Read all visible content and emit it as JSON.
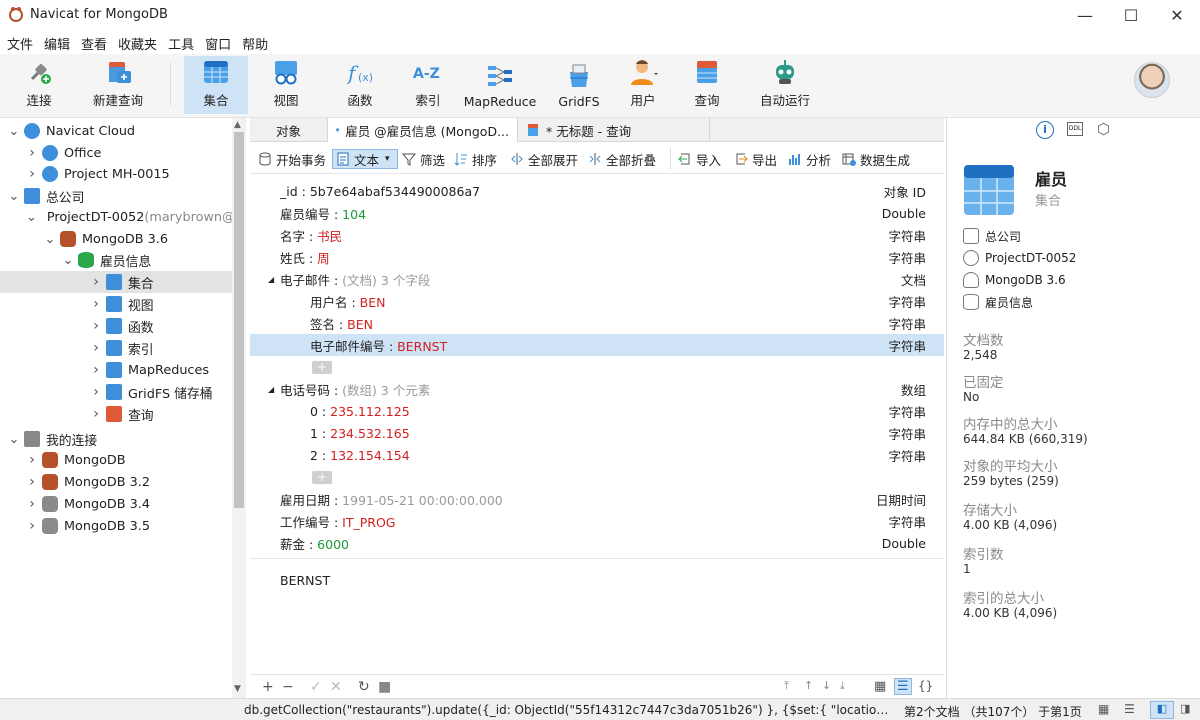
{
  "window": {
    "title": "Navicat for MongoDB",
    "minimize": "—",
    "maximize": "☐",
    "close": "✕"
  },
  "menu": [
    "文件",
    "编辑",
    "查看",
    "收藏夹",
    "工具",
    "窗口",
    "帮助"
  ],
  "toolbar": [
    {
      "label": "连接",
      "icon": "plug-icon"
    },
    {
      "label": "新建查询",
      "icon": "new-query-icon"
    },
    {
      "label": "集合",
      "icon": "collection-icon",
      "active": true
    },
    {
      "label": "视图",
      "icon": "view-icon"
    },
    {
      "label": "函数",
      "icon": "function-icon"
    },
    {
      "label": "索引",
      "icon": "index-icon"
    },
    {
      "label": "MapReduce",
      "icon": "mapreduce-icon"
    },
    {
      "label": "GridFS",
      "icon": "gridfs-icon"
    },
    {
      "label": "用户",
      "icon": "user-icon"
    },
    {
      "label": "查询",
      "icon": "query-icon"
    },
    {
      "label": "自动运行",
      "icon": "robot-icon"
    }
  ],
  "tree": [
    {
      "label": "Navicat Cloud",
      "depth": 0,
      "arrow": "down",
      "icon": "cloud-icon",
      "color": "#3c8fd8"
    },
    {
      "label": "Office",
      "depth": 1,
      "arrow": "right",
      "icon": "project-icon",
      "color": "#3c8fd8"
    },
    {
      "label": "Project MH-0015",
      "depth": 1,
      "arrow": "right",
      "icon": "project-icon",
      "color": "#3c8fd8"
    },
    {
      "label": "总公司",
      "depth": 0,
      "arrow": "down",
      "icon": "company-icon",
      "color": "#3c8fd8"
    },
    {
      "label": "ProjectDT-0052",
      "sub": " (marybrown@",
      "depth": 1,
      "arrow": "down",
      "icon": "project-icon",
      "color": "#3c8fd8"
    },
    {
      "label": "MongoDB 3.6",
      "depth": 2,
      "arrow": "down",
      "icon": "mongodb-icon",
      "color": "#b5522a"
    },
    {
      "label": "雇员信息",
      "depth": 3,
      "arrow": "down",
      "icon": "database-icon",
      "color": "#2aa84a"
    },
    {
      "label": "集合",
      "depth": 4,
      "arrow": "right",
      "icon": "collection-icon",
      "color": "#3c8fd8",
      "selected": true
    },
    {
      "label": "视图",
      "depth": 4,
      "arrow": "right",
      "icon": "view-icon",
      "color": "#3c8fd8"
    },
    {
      "label": "函数",
      "depth": 4,
      "arrow": "right",
      "icon": "function-icon",
      "color": "#3c8fd8"
    },
    {
      "label": "索引",
      "depth": 4,
      "arrow": "right",
      "icon": "index-icon",
      "color": "#3c8fd8"
    },
    {
      "label": "MapReduces",
      "depth": 4,
      "arrow": "right",
      "icon": "mapreduce-icon",
      "color": "#3c8fd8"
    },
    {
      "label": "GridFS 储存桶",
      "depth": 4,
      "arrow": "right",
      "icon": "gridfs-icon",
      "color": "#3c8fd8"
    },
    {
      "label": "查询",
      "depth": 4,
      "arrow": "right",
      "icon": "query-icon",
      "color": "#e05a3a"
    },
    {
      "label": "我的连接",
      "depth": 0,
      "arrow": "down",
      "icon": "connection-icon",
      "color": "#888888"
    },
    {
      "label": "MongoDB",
      "depth": 1,
      "arrow": "right",
      "icon": "mongodb-icon",
      "color": "#b5522a"
    },
    {
      "label": "MongoDB 3.2",
      "depth": 1,
      "arrow": "right",
      "icon": "mongodb-icon",
      "color": "#b5522a"
    },
    {
      "label": "MongoDB 3.4",
      "depth": 1,
      "arrow": "right",
      "icon": "mongodb-icon",
      "color": "#8a8a8a"
    },
    {
      "label": "MongoDB 3.5",
      "depth": 1,
      "arrow": "right",
      "icon": "mongodb-icon",
      "color": "#8a8a8a"
    }
  ],
  "tabs": [
    "对象",
    "雇员 @雇员信息 (MongoD...",
    "* 无标题 - 查询"
  ],
  "subtoolbar": [
    "开始事务",
    "文本",
    "筛选",
    "排序",
    "全部展开",
    "全部折叠",
    "导入",
    "导出",
    "分析",
    "数据生成"
  ],
  "document": [
    {
      "key": "_id : ",
      "value": "5b7e64abaf5344900086a7",
      "vclass": "",
      "type": "对象 ID",
      "indent": 0
    },
    {
      "key": "雇员编号 : ",
      "value": "104",
      "vclass": "v-num",
      "type": "Double",
      "indent": 0
    },
    {
      "key": "名字 : ",
      "value": "书民",
      "vclass": "v-str",
      "type": "字符串",
      "indent": 0
    },
    {
      "key": "姓氏 : ",
      "value": "周",
      "vclass": "v-str",
      "type": "字符串",
      "indent": 0
    },
    {
      "key": "电子邮件 : ",
      "value": "(文档) 3 个字段",
      "vclass": "v-gray",
      "type": "文档",
      "indent": 0,
      "expand": true
    },
    {
      "key": "用户名 : ",
      "value": "BEN",
      "vclass": "v-str",
      "type": "字符串",
      "indent": 1
    },
    {
      "key": "签名 : ",
      "value": "BEN",
      "vclass": "v-str",
      "type": "字符串",
      "indent": 1
    },
    {
      "key": "电子邮件编号 : ",
      "value": "BERNST",
      "vclass": "v-str",
      "type": "字符串",
      "indent": 1,
      "selected": true
    },
    {
      "plus": true,
      "indent": 1
    },
    {
      "key": "电话号码 : ",
      "value": "(数组) 3 个元素",
      "vclass": "v-gray",
      "type": "数组",
      "indent": 0,
      "expand": true
    },
    {
      "key": "0 : ",
      "value": "235.112.125",
      "vclass": "v-str",
      "type": "字符串",
      "indent": 1
    },
    {
      "key": "1 : ",
      "value": "234.532.165",
      "vclass": "v-str",
      "type": "字符串",
      "indent": 1
    },
    {
      "key": "2 : ",
      "value": "132.154.154",
      "vclass": "v-str",
      "type": "字符串",
      "indent": 1
    },
    {
      "plus": true,
      "indent": 1
    },
    {
      "key": "雇用日期 : ",
      "value": "1991-05-21 00:00:00.000",
      "vclass": "v-gray",
      "type": "日期时间",
      "indent": 0
    },
    {
      "key": "工作编号 : ",
      "value": "IT_PROG",
      "vclass": "v-str",
      "type": "字符串",
      "indent": 0
    },
    {
      "key": "薪金 : ",
      "value": "6000",
      "vclass": "v-num",
      "type": "Double",
      "indent": 0
    }
  ],
  "preview_value": "BERNST",
  "info": {
    "title": "雇员",
    "subtitle": "集合",
    "path": [
      "总公司",
      "ProjectDT-0052",
      "MongoDB 3.6",
      "雇员信息"
    ],
    "stats": [
      {
        "label": "文档数",
        "value": "2,548"
      },
      {
        "label": "已固定",
        "value": "No"
      },
      {
        "label": "内存中的总大小",
        "value": "644.84 KB (660,319)"
      },
      {
        "label": "对象的平均大小",
        "value": "259 bytes (259)"
      },
      {
        "label": "存储大小",
        "value": "4.00 KB (4,096)"
      },
      {
        "label": "索引数",
        "value": "1"
      },
      {
        "label": "索引的总大小",
        "value": "4.00 KB (4,096)"
      }
    ]
  },
  "status": {
    "query": "db.getCollection(\"restaurants\").update({_id: ObjectId(\"55f14312c7447c3da7051b26\") }, {$set:{ \"location.coord...",
    "page": "第2个文档 （共107个） 于第1页"
  }
}
